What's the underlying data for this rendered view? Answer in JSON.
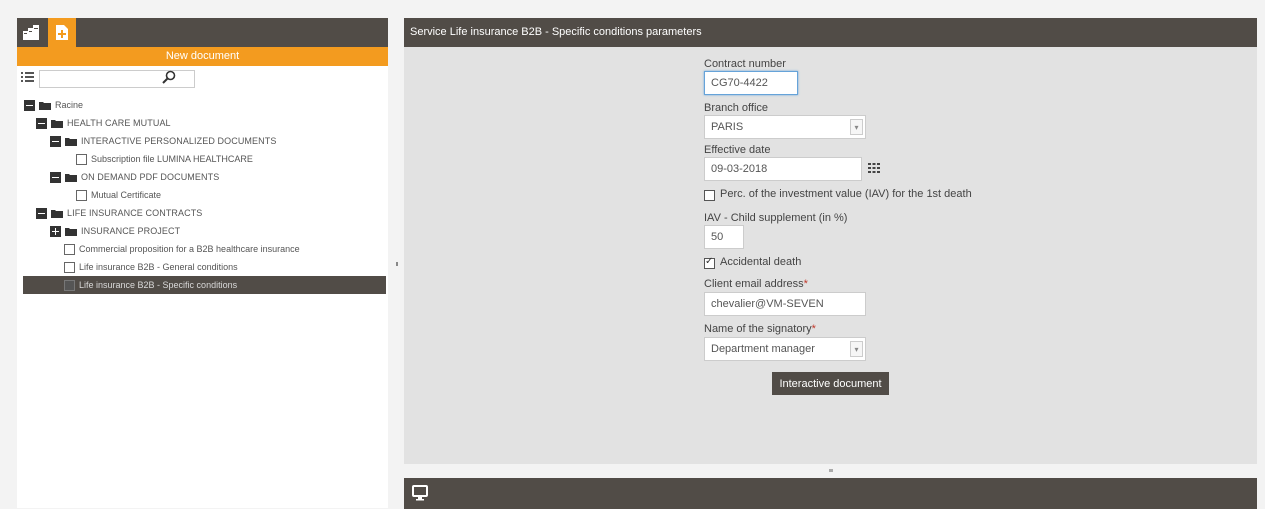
{
  "left_panel": {
    "new_document_label": "New document",
    "search": {
      "value": "",
      "placeholder": ""
    },
    "tree": [
      {
        "label": "Racine",
        "kind": "folder",
        "state": "expanded",
        "level": 0
      },
      {
        "label": "HEALTH CARE MUTUAL",
        "kind": "folder",
        "state": "expanded",
        "level": 1
      },
      {
        "label": "INTERACTIVE PERSONALIZED DOCUMENTS",
        "kind": "folder",
        "state": "expanded",
        "level": 2
      },
      {
        "label": "Subscription file LUMINA HEALTHCARE",
        "kind": "document",
        "level": 3
      },
      {
        "label": "ON DEMAND PDF DOCUMENTS",
        "kind": "folder",
        "state": "expanded",
        "level": 2
      },
      {
        "label": "Mutual Certificate",
        "kind": "document",
        "level": 3
      },
      {
        "label": "LIFE INSURANCE CONTRACTS",
        "kind": "folder",
        "state": "expanded",
        "level": 1
      },
      {
        "label": "INSURANCE PROJECT",
        "kind": "folder",
        "state": "collapsed",
        "level": 2
      },
      {
        "label": "Commercial proposition for a B2B healthcare insurance",
        "kind": "document",
        "level": 2
      },
      {
        "label": "Life insurance B2B - General conditions",
        "kind": "document",
        "level": 2
      },
      {
        "label": "Life insurance B2B - Specific conditions",
        "kind": "document",
        "level": 2,
        "selected": true
      }
    ]
  },
  "right_panel": {
    "title": "Service Life insurance B2B - Specific conditions parameters",
    "form": {
      "contract_number": {
        "label": "Contract number",
        "value": "CG70-4422"
      },
      "branch_office": {
        "label": "Branch office",
        "value": "PARIS"
      },
      "effective_date": {
        "label": "Effective date",
        "value": "09-03-2018"
      },
      "perc_iav": {
        "label": "Perc. of the investment value (IAV) for the 1st death",
        "checked": false
      },
      "iav_child": {
        "label": "IAV - Child supplement (in %)",
        "value": "50"
      },
      "accidental_death": {
        "label": "Accidental death",
        "checked": true
      },
      "client_email": {
        "label": "Client email address",
        "required_mark": "*",
        "value": "chevalier@VM-SEVEN"
      },
      "signatory": {
        "label": "Name of the signatory",
        "required_mark": "*",
        "value": "Department manager"
      }
    },
    "submit_label": "Interactive document"
  },
  "colors": {
    "dark_bar": "#514c47",
    "orange": "#f39b1f",
    "panel_bg": "#e2e2e2"
  },
  "icons": {
    "documents_tab": "documents-icon",
    "new_document_tab": "new-document-icon",
    "list": "list-icon",
    "search": "search-icon",
    "calendar": "calendar-icon",
    "monitor": "monitor-icon"
  }
}
